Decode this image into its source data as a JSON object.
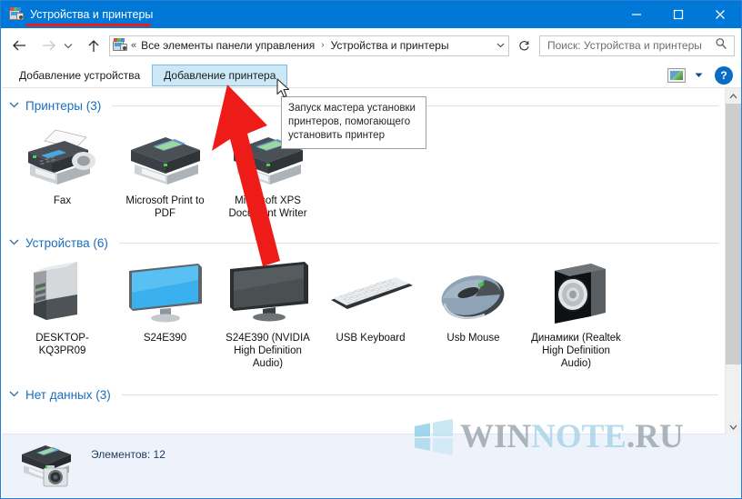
{
  "window": {
    "title": "Устройства и принтеры",
    "title_icon": "devices-printers-icon",
    "minimize_label": "—",
    "maximize_label": "□",
    "close_label": "✕"
  },
  "nav": {
    "back_label": "←",
    "forward_label": "→",
    "recent_label": "⌄",
    "up_label": "↑",
    "address_icon": "devices-printers-icon",
    "address_prefix": "«",
    "breadcrumbs": [
      "Все элементы панели управления",
      "Устройства и принтеры"
    ],
    "breadcrumb_separator": "›",
    "dropdown_label": "⌄",
    "refresh_label": "↻"
  },
  "search": {
    "placeholder": "Поиск: Устройства и принтеры",
    "icon": "search-icon"
  },
  "toolbar": {
    "add_device_label": "Добавление устройства",
    "add_printer_label": "Добавление принтера",
    "view_icon": "preview-pane-icon",
    "view_dropdown_label": "▼",
    "help_label": "?"
  },
  "tooltip": {
    "text": "Запуск мастера установки принтеров, помогающего установить принтер"
  },
  "groups": [
    {
      "chevron": "⌄",
      "label": "Принтеры (3)",
      "items": [
        {
          "label": "Fax",
          "icon": "fax-printer-icon"
        },
        {
          "label": "Microsoft Print to PDF",
          "icon": "printer-icon"
        },
        {
          "label": "Microsoft XPS Document Writer",
          "icon": "printer-icon"
        }
      ]
    },
    {
      "chevron": "⌄",
      "label": "Устройства (6)",
      "items": [
        {
          "label": "DESKTOP-KQ3PR09",
          "icon": "desktop-tower-icon"
        },
        {
          "label": "S24E390",
          "icon": "monitor-blue-icon"
        },
        {
          "label": "S24E390 (NVIDIA High Definition Audio)",
          "icon": "monitor-dark-icon"
        },
        {
          "label": "USB Keyboard",
          "icon": "keyboard-icon"
        },
        {
          "label": "Usb Mouse",
          "icon": "mouse-icon"
        },
        {
          "label": "Динамики (Realtek High Definition Audio)",
          "icon": "speaker-icon"
        }
      ]
    },
    {
      "chevron": "⌄",
      "label": "Нет данных (3)",
      "items": []
    }
  ],
  "scrollbar": {
    "up_label": "⌃",
    "down_label": "⌄"
  },
  "statusbar": {
    "items_text": "Элементов: 12",
    "preview_icon": "printer-camera-preview-icon"
  },
  "watermark": {
    "logo": "windows-logo-icon",
    "part1": "WIN",
    "part2": "NOTE",
    "part3": ".",
    "part4": "RU"
  },
  "annotations": {
    "title_underline": "red-underline-annotation",
    "arrow": "red-arrow-annotation",
    "cursor": "mouse-cursor"
  },
  "colors": {
    "titlebar": "#0078d7",
    "accent_link": "#1a6dbd",
    "annotation_red": "#ee1c18",
    "toolbar_active_bg": "#cce8f7",
    "status_bg": "#eef3fb"
  }
}
